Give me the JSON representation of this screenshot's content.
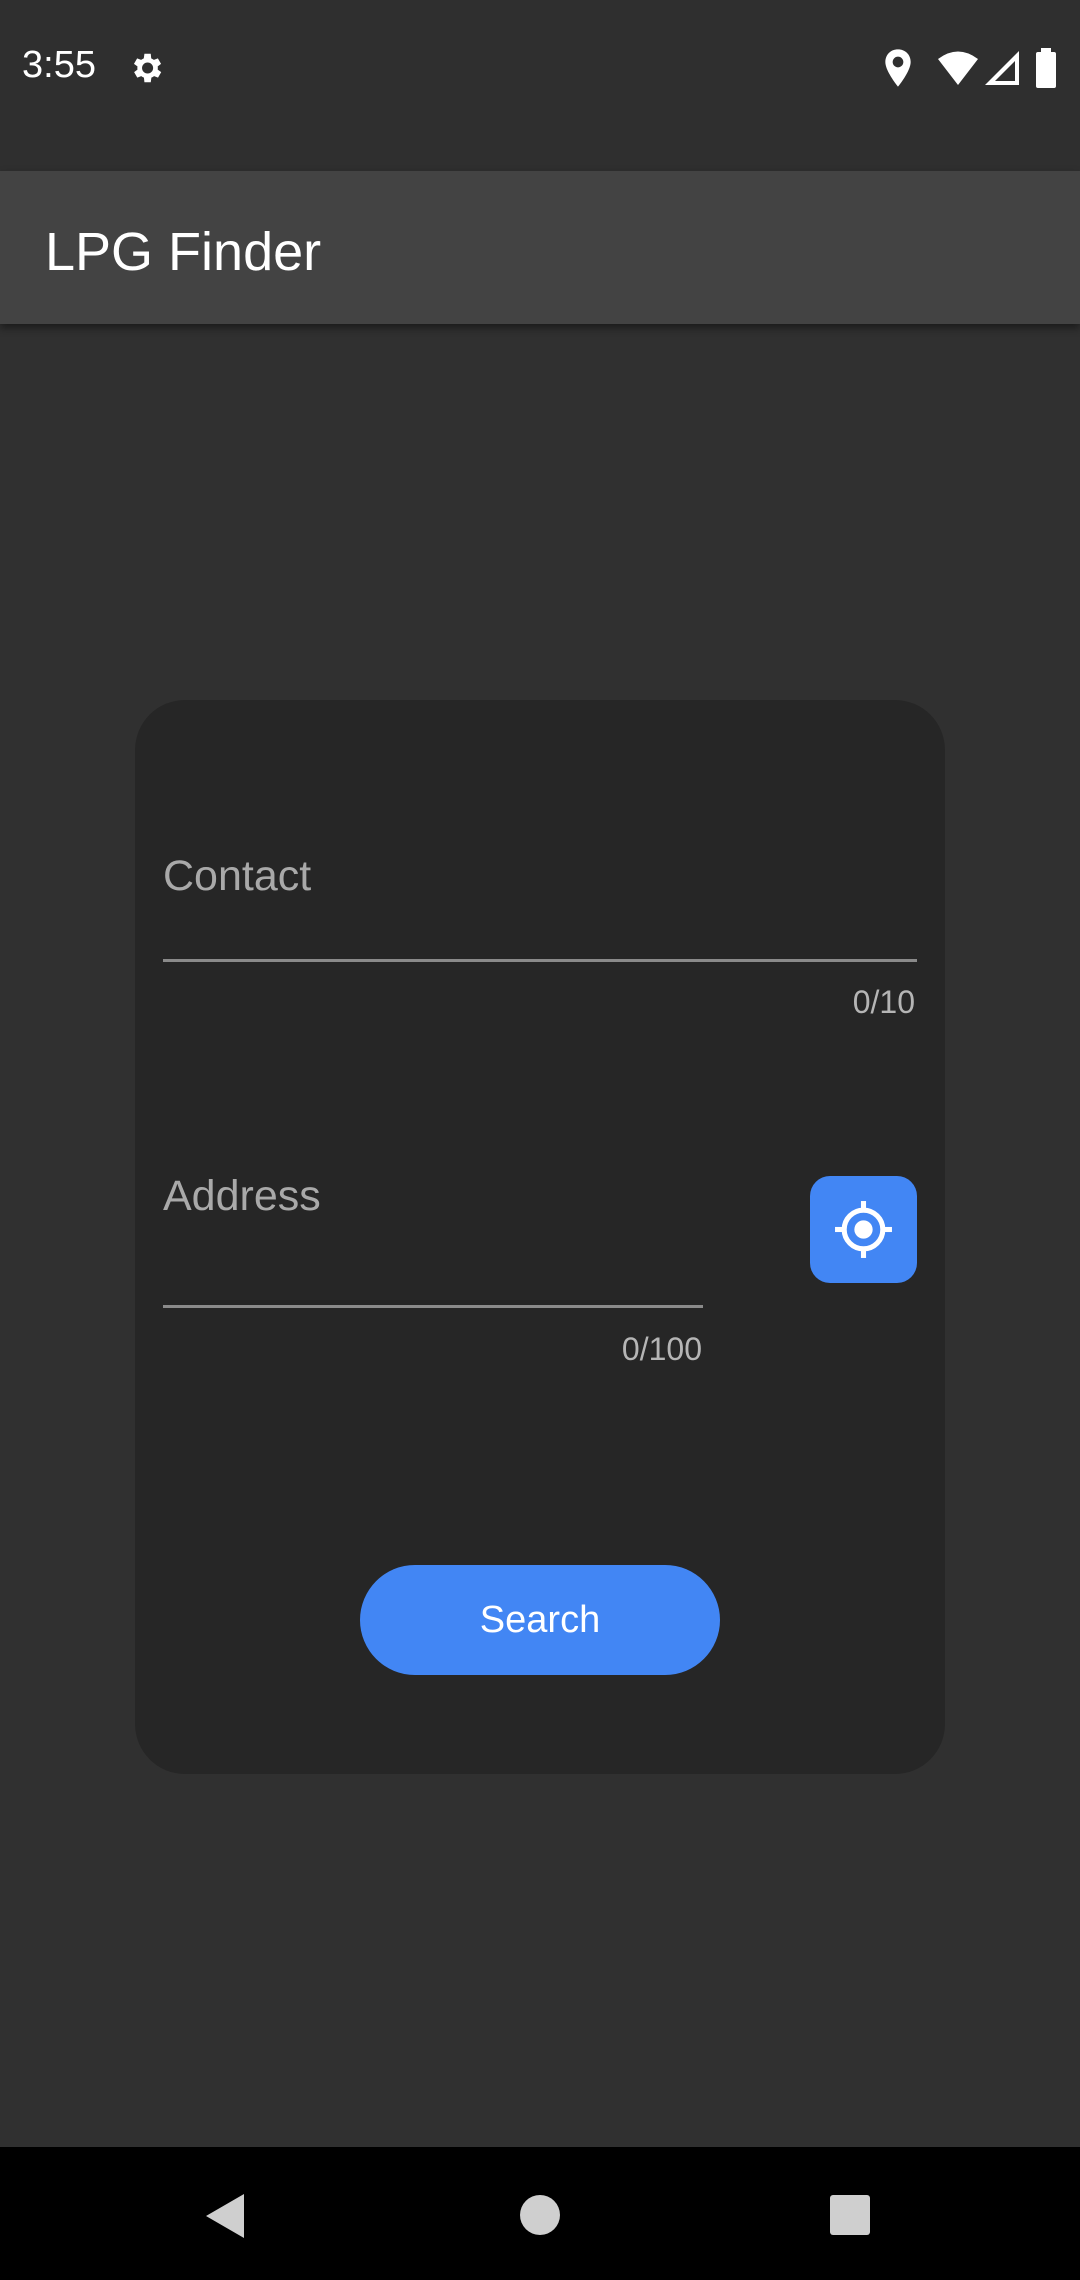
{
  "status_bar": {
    "time": "3:55",
    "icons": [
      "gear-icon",
      "location-icon",
      "wifi-icon",
      "signal-icon",
      "battery-icon"
    ]
  },
  "app_bar": {
    "title": "LPG Finder"
  },
  "form": {
    "contact": {
      "placeholder": "Contact",
      "value": "",
      "counter": "0/10"
    },
    "address": {
      "placeholder": "Address",
      "value": "",
      "counter": "0/100"
    },
    "locate_icon": "gps-target-icon",
    "search_label": "Search"
  },
  "nav_bar": {
    "icons": [
      "back-icon",
      "home-icon",
      "recents-icon"
    ]
  },
  "colors": {
    "accent": "#4286f4",
    "background": "#303030",
    "card": "#262626",
    "app_bar": "#434343"
  }
}
